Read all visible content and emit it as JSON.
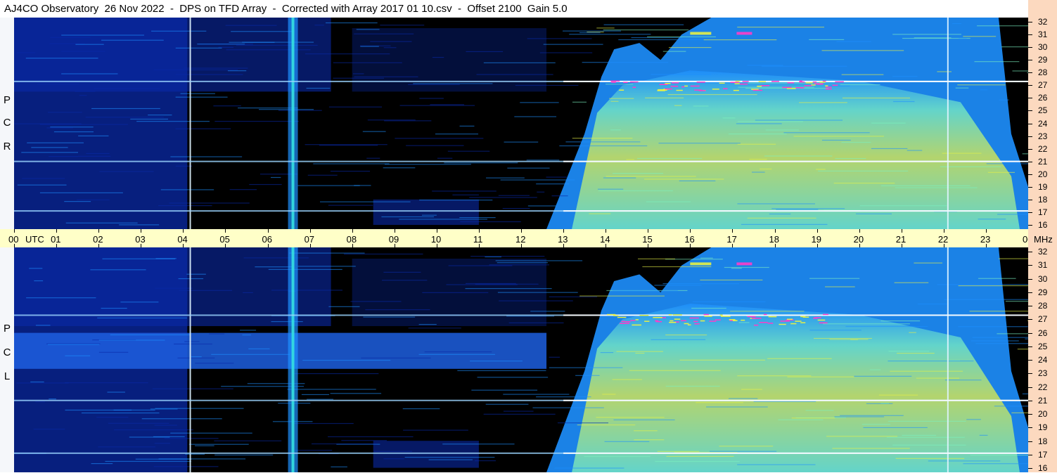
{
  "header": {
    "title": "AJ4CO Observatory  26 Nov 2022  -  DPS on TFD Array  -  Corrected with Array 2017 01 10.csv  -  Offset 2100  Gain 5.0"
  },
  "panels": [
    {
      "polarization": "RCP",
      "letters": [
        "P",
        "C",
        "R"
      ]
    },
    {
      "polarization": "LCP",
      "letters": [
        "P",
        "C",
        "L"
      ]
    }
  ],
  "chart_data": {
    "type": "heatmap",
    "title": "AJ4CO Observatory  26 Nov 2022  -  DPS on TFD Array  -  Corrected with Array 2017 01 10.csv  -  Offset 2100  Gain 5.0",
    "x_unit_label": "UTC",
    "y_unit_label": "MHz",
    "x_ticks": [
      "00",
      "01",
      "02",
      "03",
      "04",
      "05",
      "06",
      "07",
      "08",
      "09",
      "10",
      "11",
      "12",
      "13",
      "14",
      "15",
      "16",
      "17",
      "18",
      "19",
      "20",
      "21",
      "22",
      "23",
      "00"
    ],
    "x_range_hours": [
      0,
      24
    ],
    "y_ticks": [
      "32",
      "31",
      "30",
      "29",
      "28",
      "27",
      "26",
      "25",
      "24",
      "23",
      "22",
      "21",
      "20",
      "19",
      "18",
      "17",
      "16"
    ],
    "y_range_mhz": [
      16,
      32
    ],
    "series": [
      {
        "name": "RCP",
        "notes_frequencies_mhz": [
          27.3,
          21.0,
          17.1
        ]
      },
      {
        "name": "LCP",
        "notes_frequencies_mhz": [
          27.3,
          21.0,
          17.1
        ]
      }
    ],
    "features": {
      "vertical_interference_hours": [
        4.17,
        6.6,
        22.1
      ],
      "daytime_noise_start_hour": 12.6,
      "daytime_noise_end_hour": 24
    },
    "colors": {
      "background_dark": "#000000",
      "low": "#0a2aa8",
      "mid": "#1e90ff",
      "high": "#7cf0c0",
      "peak": "#e6f046",
      "hot": "#ff3cc8"
    }
  }
}
